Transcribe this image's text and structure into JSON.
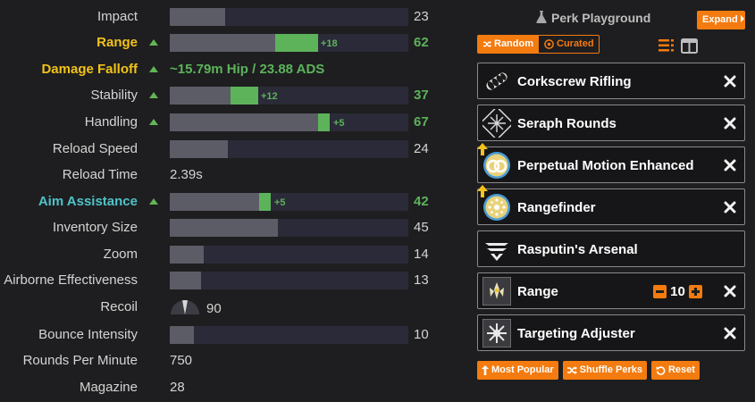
{
  "stats": {
    "impact": {
      "label": "Impact",
      "value": "23",
      "fill": 23
    },
    "range": {
      "label": "Range",
      "value": "62",
      "base": 44,
      "bonus": 18,
      "delta": "+18"
    },
    "falloff": {
      "label": "Damage Falloff",
      "value": "~15.79m Hip / 23.88 ADS"
    },
    "stability": {
      "label": "Stability",
      "value": "37",
      "base": 25,
      "bonus": 12,
      "delta": "+12"
    },
    "handling": {
      "label": "Handling",
      "value": "67",
      "base": 62,
      "bonus": 5,
      "delta": "+5"
    },
    "reload_speed": {
      "label": "Reload Speed",
      "value": "24",
      "fill": 24
    },
    "reload_time": {
      "label": "Reload Time",
      "value": "2.39s"
    },
    "aim_assist": {
      "label": "Aim Assistance",
      "value": "42",
      "base": 37,
      "bonus": 5,
      "delta": "+5"
    },
    "inventory": {
      "label": "Inventory Size",
      "value": "45",
      "fill": 45
    },
    "zoom": {
      "label": "Zoom",
      "value": "14",
      "fill": 14
    },
    "airborne": {
      "label": "Airborne Effectiveness",
      "value": "13",
      "fill": 13
    },
    "recoil": {
      "label": "Recoil",
      "value": "90"
    },
    "bounce": {
      "label": "Bounce Intensity",
      "value": "10",
      "fill": 10
    },
    "rpm": {
      "label": "Rounds Per Minute",
      "value": "750"
    },
    "magazine": {
      "label": "Magazine",
      "value": "28"
    }
  },
  "panel": {
    "title": "Perk Playground",
    "expand_label": "Expand",
    "tab_random": "Random",
    "tab_curated": "Curated"
  },
  "perks": [
    {
      "name": "Corkscrew Rifling"
    },
    {
      "name": "Seraph Rounds"
    },
    {
      "name": "Perpetual Motion Enhanced"
    },
    {
      "name": "Rangefinder"
    },
    {
      "name": "Rasputin's Arsenal"
    },
    {
      "name": "Range",
      "level": "10"
    },
    {
      "name": "Targeting Adjuster"
    }
  ],
  "actions": {
    "most_popular": "Most Popular",
    "shuffle": "Shuffle Perks",
    "reset": "Reset"
  },
  "colors": {
    "accent": "#f37b0f",
    "boost": "#5cb35a",
    "highlight_yellow": "#f2c21a",
    "highlight_cyan": "#4fc3c9"
  }
}
